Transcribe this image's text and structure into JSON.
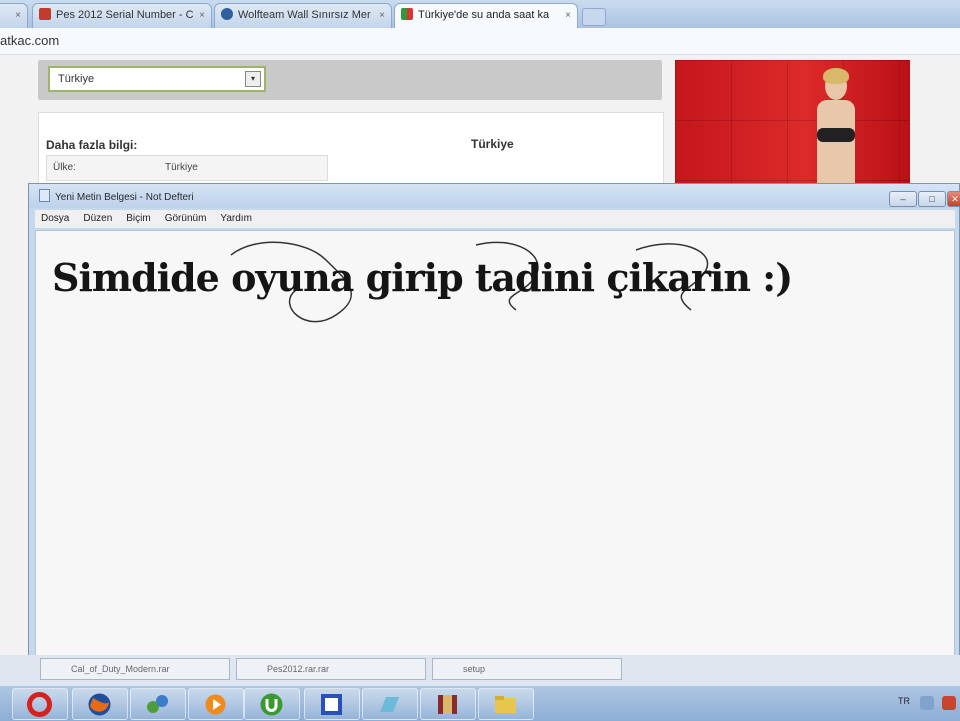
{
  "browser": {
    "tabs": [
      {
        "label": "Pes 2012 Serial Number - C",
        "active": false
      },
      {
        "label": "Wolfteam Wall Sınırsız Mer",
        "active": false
      },
      {
        "label": "Türkiye'de su anda saat ka",
        "active": true
      }
    ],
    "address": "atkac.com"
  },
  "page": {
    "country_select": {
      "value": "Türkiye"
    },
    "info_title": "Daha fazla bilgi:",
    "info_row": {
      "key": "Ülke:",
      "value": "Türkiye"
    },
    "country_heading": "Türkiye"
  },
  "notepad": {
    "title": "Yeni Metin Belgesi - Not Defteri",
    "menu": [
      "Dosya",
      "Düzen",
      "Biçim",
      "Görünüm",
      "Yardım"
    ],
    "content": "Simdide oyuna girip tadini çikarin :)"
  },
  "behind_tabs": [
    {
      "label": "Cal_of_Duty_Modern.rar"
    },
    {
      "label": "Pes2012.rar.rar"
    },
    {
      "label": "setup"
    }
  ],
  "taskbar": {
    "apps": [
      {
        "icon": "opera-icon",
        "color": "#d6211c"
      },
      {
        "icon": "firefox-icon",
        "color": "#e66b14"
      },
      {
        "icon": "network-icon",
        "color": "#4d9e3a"
      },
      {
        "icon": "media-player-icon",
        "color": "#f08a1c"
      },
      {
        "icon": "utorrent-icon",
        "color": "#3a9a2f"
      },
      {
        "icon": "window-app-icon",
        "color": "#2b4fb8"
      },
      {
        "icon": "notepad-icon",
        "color": "#6bbad6"
      },
      {
        "icon": "winrar-icon",
        "color": "#8a2b2b"
      },
      {
        "icon": "folder-icon",
        "color": "#e8c54f"
      }
    ],
    "language": "TR"
  }
}
